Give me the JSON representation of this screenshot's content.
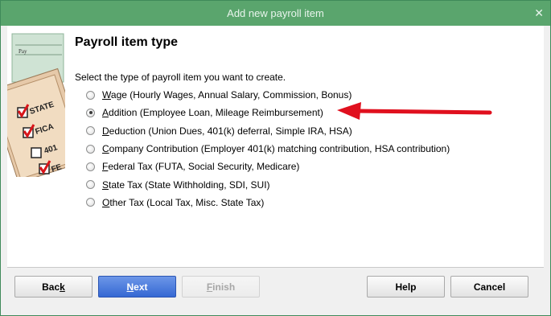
{
  "window": {
    "title": "Add new payroll item",
    "close_glyph": "✕"
  },
  "illustration": {
    "labels": [
      "Pay",
      "STATE",
      "FICA",
      "401",
      "FE"
    ]
  },
  "heading": "Payroll item type",
  "prompt": "Select the type of payroll item you want to create.",
  "options": [
    {
      "key": "W",
      "rest": "age (Hourly Wages, Annual Salary, Commission, Bonus)",
      "selected": false
    },
    {
      "key": "A",
      "rest": "ddition (Employee Loan, Mileage Reimbursement)",
      "selected": true
    },
    {
      "key": "D",
      "rest": "eduction (Union Dues, 401(k) deferral, Simple IRA, HSA)",
      "selected": false
    },
    {
      "key": "C",
      "rest": "ompany Contribution (Employer 401(k) matching contribution, HSA contribution)",
      "selected": false
    },
    {
      "key": "F",
      "rest": "ederal Tax (FUTA, Social Security, Medicare)",
      "selected": false
    },
    {
      "key": "S",
      "rest": "tate Tax (State Withholding, SDI, SUI)",
      "selected": false
    },
    {
      "key": "O",
      "rest": "ther Tax (Local Tax, Misc. State Tax)",
      "selected": false
    }
  ],
  "buttons": {
    "back": {
      "pre": "Bac",
      "key": "k",
      "post": ""
    },
    "next": {
      "pre": "",
      "key": "N",
      "post": "ext"
    },
    "finish": {
      "pre": "",
      "key": "F",
      "post": "inish"
    },
    "help": "Help",
    "cancel": "Cancel"
  },
  "colors": {
    "titlebar": "#5aa56d",
    "primary_button": "#3568d3",
    "arrow": "#e0101e"
  }
}
